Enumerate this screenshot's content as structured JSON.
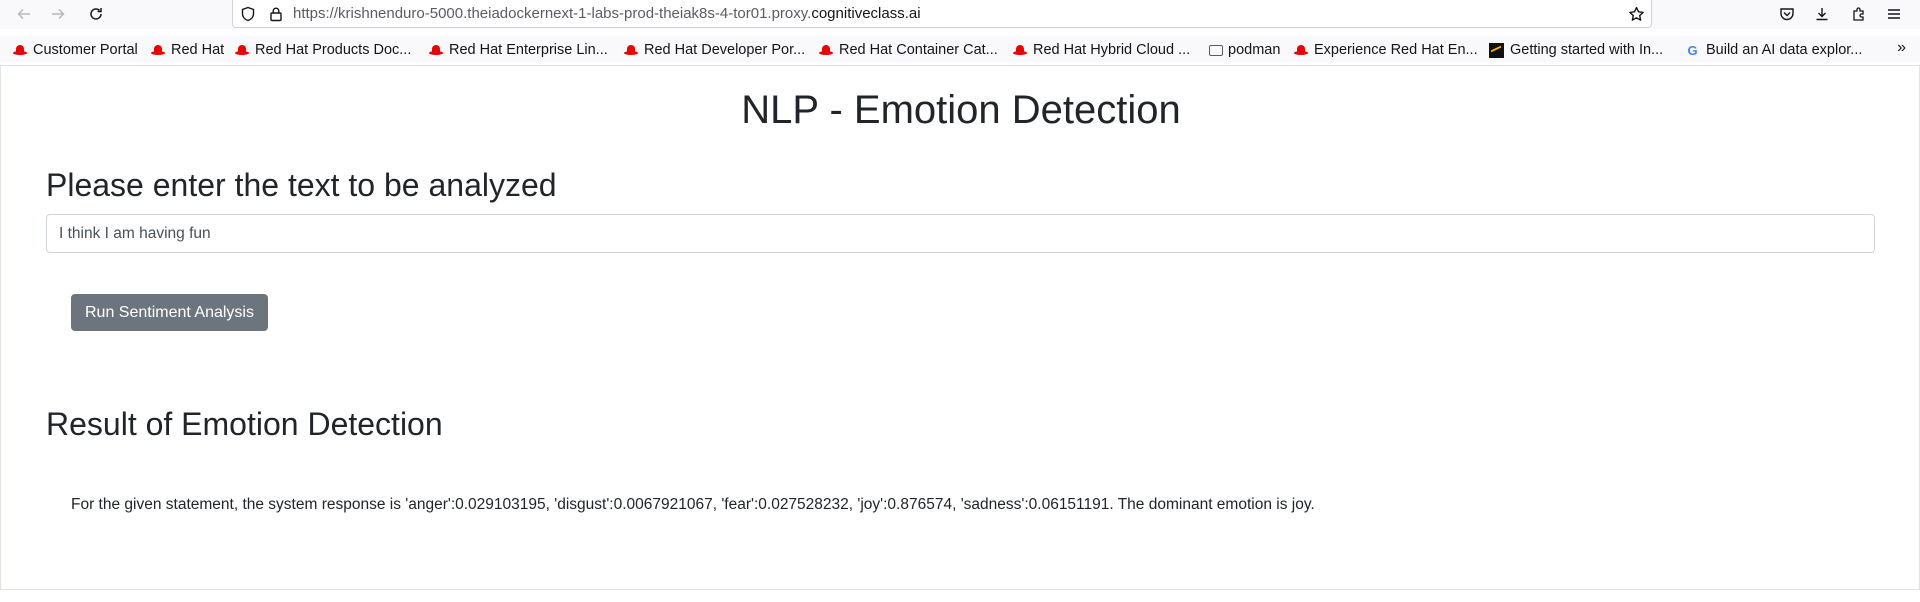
{
  "browser": {
    "url_prefix": "https://krishnenduro-5000.theiadockernext-1-labs-prod-theiak8s-4-tor01.proxy.",
    "url_domain": "cognitiveclass.ai",
    "icons": {
      "back": "back-arrow-icon",
      "forward": "forward-arrow-icon",
      "reload": "reload-icon",
      "shield": "shield-icon",
      "lock": "lock-icon",
      "star": "bookmark-star-icon",
      "pocket": "pocket-icon",
      "downloads": "download-icon",
      "extensions": "extensions-icon",
      "menu": "hamburger-menu-icon"
    }
  },
  "bookmarks": {
    "items": [
      {
        "label": "Customer Portal",
        "icon": "redhat-icon"
      },
      {
        "label": "Red Hat",
        "icon": "redhat-icon"
      },
      {
        "label": "Red Hat Products Doc...",
        "icon": "redhat-icon"
      },
      {
        "label": "Red Hat Enterprise Lin...",
        "icon": "redhat-icon"
      },
      {
        "label": "Red Hat Developer Por...",
        "icon": "redhat-icon"
      },
      {
        "label": "Red Hat Container Cat...",
        "icon": "redhat-icon"
      },
      {
        "label": "Red Hat Hybrid Cloud ...",
        "icon": "redhat-icon"
      },
      {
        "label": "podman",
        "icon": "folder-icon"
      },
      {
        "label": "Experience Red Hat En...",
        "icon": "redhat-icon"
      },
      {
        "label": "Getting started with In...",
        "icon": "chart-favicon-icon"
      },
      {
        "label": "Build an AI data explor...",
        "icon": "google-icon"
      }
    ],
    "overflow": "»"
  },
  "page": {
    "title": "NLP - Emotion Detection",
    "prompt_heading": "Please enter the text to be analyzed",
    "input_value": "I think I am having fun",
    "run_button_label": "Run Sentiment Analysis",
    "result_heading": "Result of Emotion Detection",
    "result_text": "For the given statement, the system response is 'anger':0.029103195, 'disgust':0.0067921067, 'fear':0.027528232, 'joy':0.876574, 'sadness':0.06151191. The dominant emotion is joy."
  }
}
